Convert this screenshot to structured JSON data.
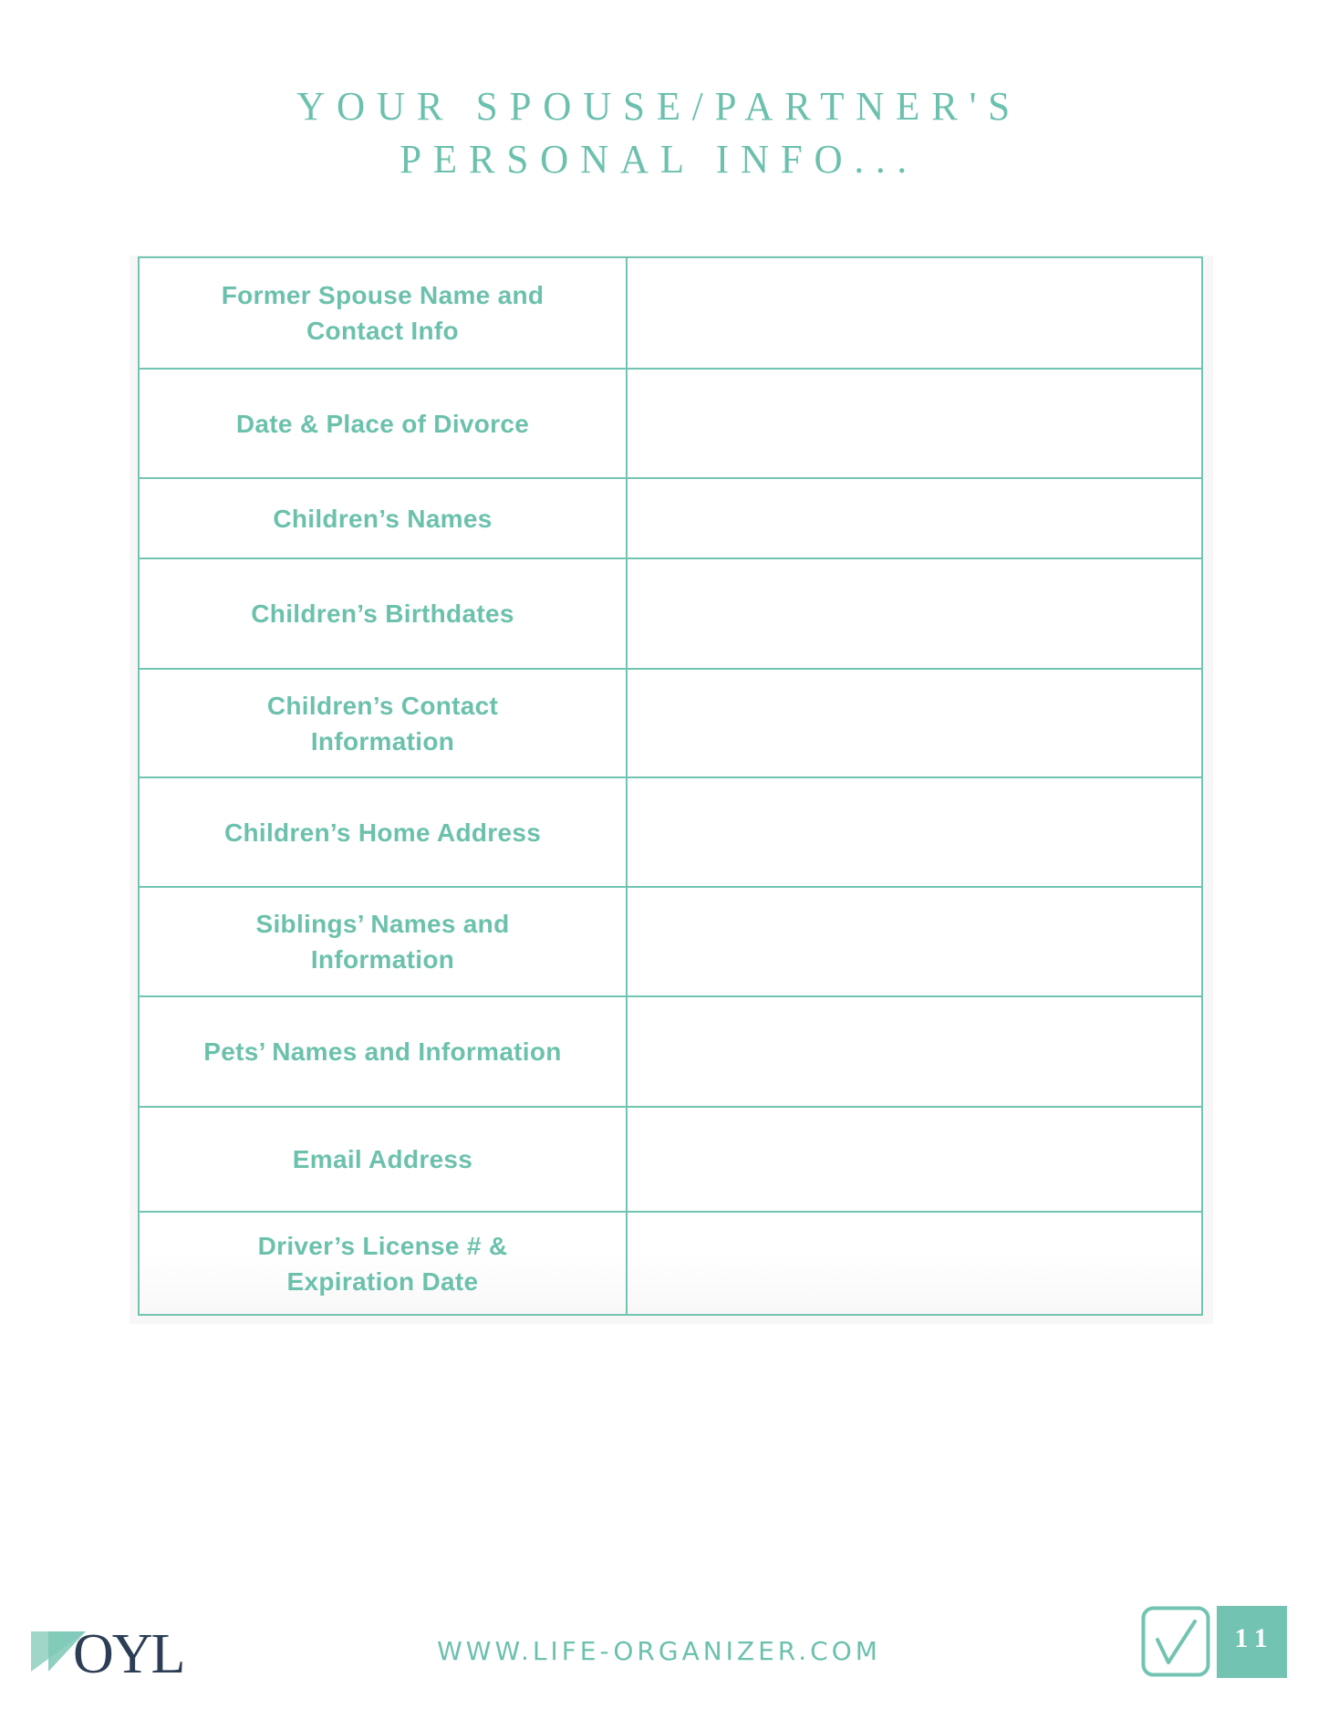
{
  "header": {
    "title_lines": [
      "YOUR SPOUSE/PARTNER'S",
      "PERSONAL INFO..."
    ]
  },
  "form": {
    "rows": [
      {
        "label_lines": [
          "Former Spouse Name and",
          "Contact Info"
        ],
        "value": ""
      },
      {
        "label_lines": [
          "Date & Place of Divorce"
        ],
        "value": ""
      },
      {
        "label_lines": [
          "Children’s Names"
        ],
        "value": ""
      },
      {
        "label_lines": [
          "Children’s Birthdates"
        ],
        "value": ""
      },
      {
        "label_lines": [
          "Children’s Contact",
          "Information"
        ],
        "value": ""
      },
      {
        "label_lines": [
          "Children’s Home Address"
        ],
        "value": ""
      },
      {
        "label_lines": [
          "Siblings’ Names and",
          "Information"
        ],
        "value": ""
      },
      {
        "label_lines": [
          "Pets’ Names and Information"
        ],
        "value": ""
      },
      {
        "label_lines": [
          "Email Address"
        ],
        "value": ""
      },
      {
        "label_lines": [
          "Driver’s License # &",
          "Expiration Date"
        ],
        "value": ""
      }
    ]
  },
  "footer": {
    "logo_text": "OYL",
    "logo_icon": "triangle-mark-icon",
    "url": "WWW.LIFE-ORGANIZER.COM",
    "check_icon": "checkbox-check-icon",
    "page_number": "11"
  },
  "colors": {
    "accent": "#6cc0ae",
    "border": "#72c4b2",
    "logo_dark": "#2c3e55",
    "page_badge": "#72c3b1"
  }
}
